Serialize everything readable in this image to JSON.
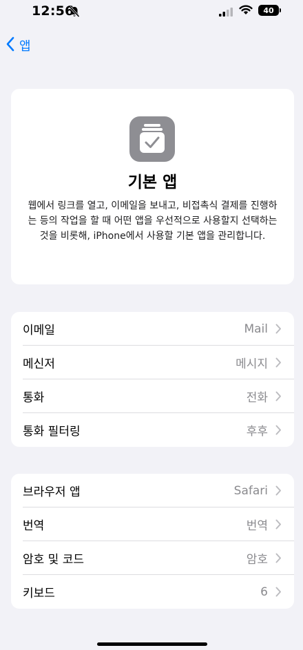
{
  "status_bar": {
    "time": "12:56",
    "battery": "40"
  },
  "nav": {
    "back_label": "앱"
  },
  "header": {
    "icon": "checkmark-stack-icon",
    "title": "기본 앱",
    "description": "웹에서 링크를 열고, 이메일을 보내고, 비접촉식 결제를 진행하는 등의 작업을 할 때 어떤 앱을 우선적으로 사용할지 선택하는 것을 비롯해, iPhone에서 사용할 기본 앱을 관리합니다."
  },
  "section1": {
    "rows": [
      {
        "label": "이메일",
        "value": "Mail"
      },
      {
        "label": "메신저",
        "value": "메시지"
      },
      {
        "label": "통화",
        "value": "전화"
      },
      {
        "label": "통화 필터링",
        "value": "후후"
      }
    ]
  },
  "section2": {
    "rows": [
      {
        "label": "브라우저 앱",
        "value": "Safari"
      },
      {
        "label": "번역",
        "value": "번역"
      },
      {
        "label": "암호 및 코드",
        "value": "암호"
      },
      {
        "label": "키보드",
        "value": "6"
      }
    ]
  },
  "colors": {
    "accent": "#007aff",
    "background": "#f2f2f7",
    "card": "#ffffff",
    "secondary_text": "#8a8a8e"
  }
}
